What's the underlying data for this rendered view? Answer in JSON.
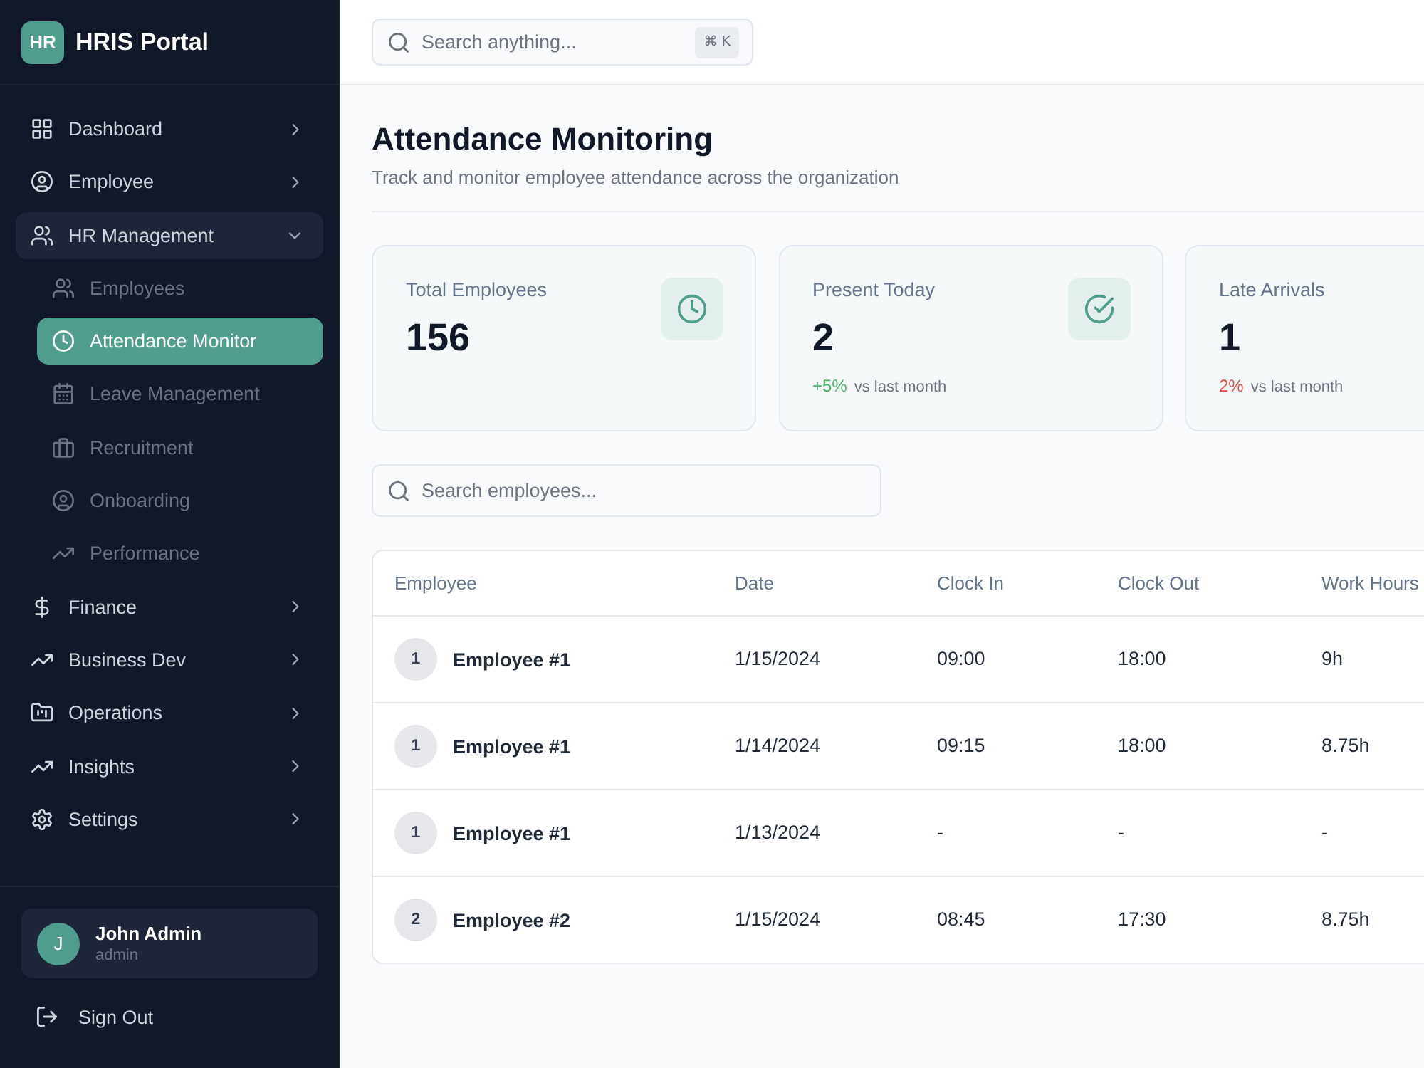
{
  "sidebar": {
    "logo": "HR",
    "title": "HRIS Portal",
    "nav": [
      {
        "label": "Dashboard",
        "selected": false,
        "expanded": false
      },
      {
        "label": "Employee",
        "selected": false,
        "expanded": false
      },
      {
        "label": "HR Management",
        "selected": false,
        "expanded": true,
        "children": [
          {
            "label": "Employees",
            "selected": false
          },
          {
            "label": "Attendance Monitor",
            "selected": true
          },
          {
            "label": "Leave Management",
            "selected": false
          },
          {
            "label": "Recruitment",
            "selected": false
          },
          {
            "label": "Onboarding",
            "selected": false
          },
          {
            "label": "Performance",
            "selected": false
          }
        ]
      },
      {
        "label": "Finance",
        "selected": false,
        "expanded": false
      },
      {
        "label": "Business Dev",
        "selected": false,
        "expanded": false
      },
      {
        "label": "Operations",
        "selected": false,
        "expanded": false
      },
      {
        "label": "Insights",
        "selected": false,
        "expanded": false
      },
      {
        "label": "Settings",
        "selected": false,
        "expanded": false
      }
    ],
    "user": {
      "avatar": "J",
      "name": "John Admin",
      "role": "admin"
    },
    "sign_out": "Sign Out"
  },
  "top_bar": {
    "search": {
      "placeholder": "Search anything...",
      "shortcut": "⌘ K"
    }
  },
  "page": {
    "title": "Attendance Monitoring",
    "subtitle": "Track and monitor employee attendance across the organization"
  },
  "stats": [
    {
      "label": "Total Employees",
      "value": "156"
    },
    {
      "label": "Present Today",
      "value": "2",
      "change": "+5%",
      "positive": true,
      "note": "vs last month"
    },
    {
      "label": "Late Arrivals",
      "value": "1",
      "change": "2%",
      "positive": false,
      "note": "vs last month"
    }
  ],
  "employee_search": {
    "placeholder": "Search employees..."
  },
  "table": {
    "columns": [
      "Employee",
      "Date",
      "Clock In",
      "Clock Out",
      "Work Hours"
    ],
    "rows": [
      {
        "avatar": "1",
        "cells": [
          "Employee #1",
          "1/15/2024",
          "09:00",
          "18:00",
          "9h"
        ]
      },
      {
        "avatar": "1",
        "cells": [
          "Employee #1",
          "1/14/2024",
          "09:15",
          "18:00",
          "8.75h"
        ]
      },
      {
        "avatar": "1",
        "cells": [
          "Employee #1",
          "1/13/2024",
          "-",
          "-",
          "-"
        ]
      },
      {
        "avatar": "2",
        "cells": [
          "Employee #2",
          "1/15/2024",
          "08:45",
          "17:30",
          "8.75h"
        ]
      }
    ]
  }
}
